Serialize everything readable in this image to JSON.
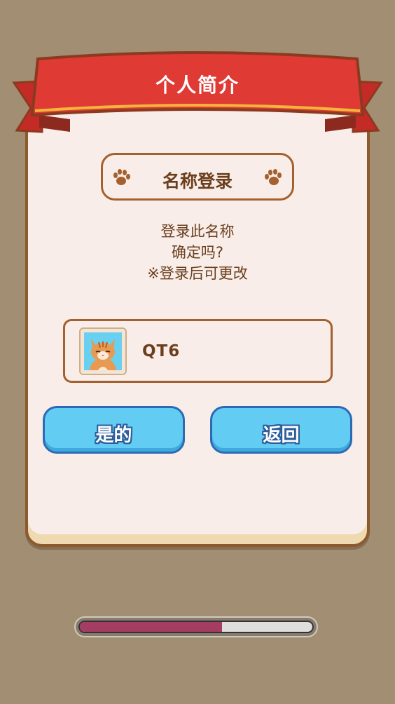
{
  "header": {
    "title": "个人简介"
  },
  "dialog": {
    "subtitle": "名称登录",
    "message_lines": [
      "登录此名称",
      "确定吗?",
      "※登录后可更改"
    ],
    "player_name": "QT6"
  },
  "buttons": {
    "confirm_label": "是的",
    "back_label": "返回"
  },
  "loading": {
    "progress": 0.61
  },
  "icons": {
    "subtitle_left": "paw-icon",
    "subtitle_right": "paw-icon",
    "avatar": "cat-avatar-icon"
  },
  "colors": {
    "background": "#a18e73",
    "ribbon": "#e03a34",
    "panel": "#f8ede8",
    "text_brown": "#6b3f1e",
    "button_blue": "#62ccf3",
    "progress_fill": "#a43c63"
  }
}
